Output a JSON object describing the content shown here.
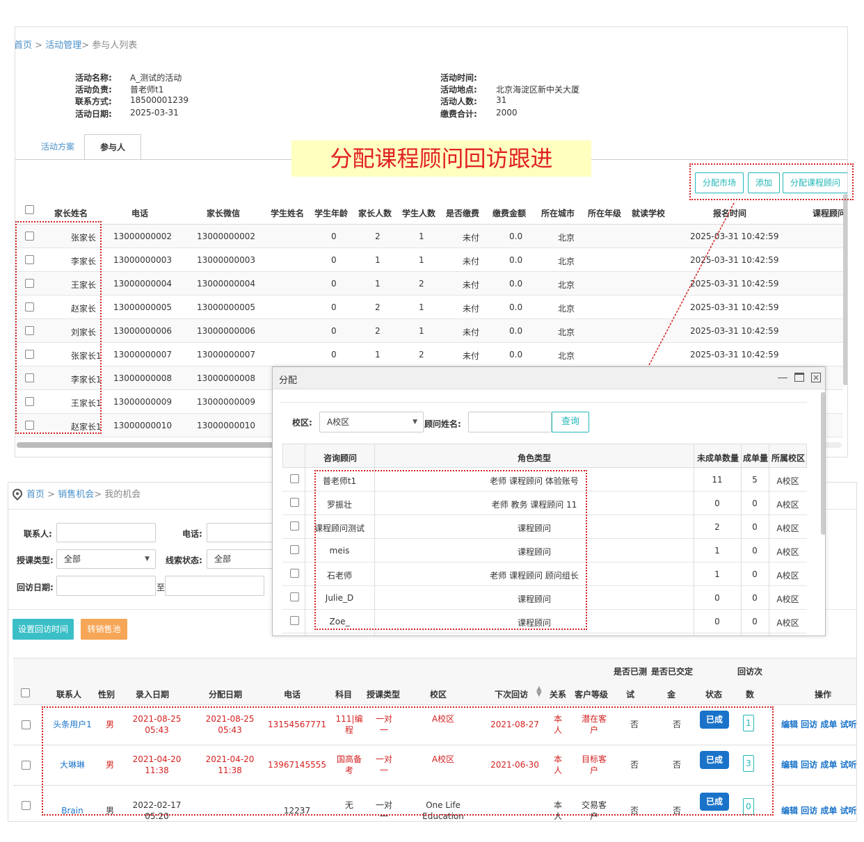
{
  "breadcrumb1": {
    "home": "首页",
    "sep1": " > ",
    "section": "活动管理",
    "sep2": "> ",
    "current": "参与人列表"
  },
  "activity": {
    "name_label": "活动名称:",
    "name": "A_测试的活动",
    "owner_label": "活动负责:",
    "owner": "普老师t1",
    "phone_label": "联系方式:",
    "phone": "18500001239",
    "date_label": "活动日期:",
    "date": "2025-03-31",
    "time_label": "活动时间:",
    "time": "",
    "place_label": "活动地点:",
    "place": "北京海淀区新中关大厦",
    "count_label": "活动人数:",
    "count": "31",
    "fee_label": "缴费合计:",
    "fee": "2000"
  },
  "tabs": {
    "plan": "活动方案",
    "participants": "参与人"
  },
  "banner": "分配课程顾问回访跟进",
  "toolbar": {
    "assign_market": "分配市场",
    "add": "添加",
    "assign_advisor": "分配课程顾问"
  },
  "participants": {
    "headers": {
      "parent_name": "家长姓名",
      "phone": "电话",
      "wechat": "家长微信",
      "student_name": "学生姓名",
      "student_age": "学生年龄",
      "parent_count": "家长人数",
      "student_count": "学生人数",
      "paid": "是否缴费",
      "amount": "缴费金额",
      "city": "所在城市",
      "grade": "所在年级",
      "school": "就读学校",
      "signup_time": "报名时间",
      "advisor": "课程顾问"
    },
    "rows": [
      {
        "name": "张家长",
        "phone": "13000000002",
        "wechat": "13000000002",
        "age": "0",
        "parents": "2",
        "students": "1",
        "paid": "未付",
        "amount": "0.0",
        "city": "北京",
        "time": "2025-03-31 10:42:59"
      },
      {
        "name": "李家长",
        "phone": "13000000003",
        "wechat": "13000000003",
        "age": "0",
        "parents": "1",
        "students": "1",
        "paid": "未付",
        "amount": "0.0",
        "city": "北京",
        "time": "2025-03-31 10:42:59"
      },
      {
        "name": "王家长",
        "phone": "13000000004",
        "wechat": "13000000004",
        "age": "0",
        "parents": "1",
        "students": "2",
        "paid": "未付",
        "amount": "0.0",
        "city": "北京",
        "time": "2025-03-31 10:42:59"
      },
      {
        "name": "赵家长",
        "phone": "13000000005",
        "wechat": "13000000005",
        "age": "0",
        "parents": "2",
        "students": "1",
        "paid": "未付",
        "amount": "0.0",
        "city": "北京",
        "time": "2025-03-31 10:42:59"
      },
      {
        "name": "刘家长",
        "phone": "13000000006",
        "wechat": "13000000006",
        "age": "0",
        "parents": "2",
        "students": "1",
        "paid": "未付",
        "amount": "0.0",
        "city": "北京",
        "time": "2025-03-31 10:42:59"
      },
      {
        "name": "张家长1",
        "phone": "13000000007",
        "wechat": "13000000007",
        "age": "0",
        "parents": "1",
        "students": "2",
        "paid": "未付",
        "amount": "0.0",
        "city": "北京",
        "time": "2025-03-31 10:42:59"
      },
      {
        "name": "李家长1",
        "phone": "13000000008",
        "wechat": "13000000008"
      },
      {
        "name": "王家长1",
        "phone": "13000000009",
        "wechat": "13000000009"
      },
      {
        "name": "赵家长1",
        "phone": "13000000010",
        "wechat": "13000000010"
      }
    ]
  },
  "dialog": {
    "title": "分配",
    "campus_label": "校区:",
    "campus_value": "A校区",
    "advisor_name_label": "顾问姓名:",
    "advisor_name_value": "",
    "search_button": "查询",
    "headers": {
      "advisor": "咨询顾问",
      "role": "角色类型",
      "open": "未成单数量",
      "closed": "成单量",
      "campus": "所属校区"
    },
    "rows": [
      {
        "name": "普老师t1",
        "role": "老师 课程顾问 体验账号",
        "open": "11",
        "closed": "5",
        "campus": "A校区"
      },
      {
        "name": "罗振壮",
        "role": "老师 教务 课程顾问 11",
        "open": "0",
        "closed": "0",
        "campus": "A校区"
      },
      {
        "name": "课程顾问测试",
        "role": "课程顾问",
        "open": "2",
        "closed": "0",
        "campus": "A校区"
      },
      {
        "name": "meis",
        "role": "课程顾问",
        "open": "1",
        "closed": "0",
        "campus": "A校区"
      },
      {
        "name": "石老师",
        "role": "老师 课程顾问 顾问组长",
        "open": "1",
        "closed": "0",
        "campus": "A校区"
      },
      {
        "name": "Julie_D",
        "role": "课程顾问",
        "open": "0",
        "closed": "0",
        "campus": "A校区"
      },
      {
        "name": "Zoe_",
        "role": "课程顾问",
        "open": "0",
        "closed": "0",
        "campus": "A校区"
      }
    ]
  },
  "breadcrumb2": {
    "home": "首页",
    "sep1": " > ",
    "section": "销售机会",
    "sep2": "> ",
    "current": "我的机会"
  },
  "filters": {
    "contact_label": "联系人:",
    "contact_value": "",
    "phone_label": "电话:",
    "phone_value": "",
    "course_type_label": "授课类型:",
    "course_type_value": "全部",
    "lead_status_label": "线索状态:",
    "lead_status_value": "全部",
    "visit_date_label": "回访日期:",
    "to_label": "至"
  },
  "actions": {
    "set_visit_time": "设置回访时间",
    "transfer_pool": "转销售池"
  },
  "opportunities": {
    "headers": {
      "contact": "联系人",
      "gender": "性别",
      "entry_date": "录入日期",
      "assign_date": "分配日期",
      "phone": "电话",
      "subject": "科目",
      "course_type": "授课类型",
      "campus": "校区",
      "next_visit": "下次回访",
      "relation": "关系",
      "level": "客户等级",
      "tested_a": "是否已测",
      "tested_b": "试",
      "paid_a": "是否已交定",
      "paid_b": "金",
      "status": "状态",
      "visits_a": "回访次",
      "visits_b": "数",
      "ops": "操作"
    },
    "rows": [
      {
        "contact": "头条用户1",
        "gender": "男",
        "entry_a": "2021-08-25",
        "entry_b": "05:43",
        "assign_a": "2021-08-25",
        "assign_b": "05:43",
        "phone": "13154567771",
        "subject_a": "111|编",
        "subject_b": "程",
        "type_a": "一对",
        "type_b": "一",
        "campus_a": "A校区",
        "campus_b": "",
        "next": "2021-08-27",
        "rel_a": "本",
        "rel_b": "人",
        "level_a": "潜在客",
        "level_b": "户",
        "tested": "否",
        "paid": "否",
        "status": "已成",
        "visits": "1",
        "ops": "编辑 回访 成单 试听",
        "red": true
      },
      {
        "contact": "大琳琳",
        "gender": "男",
        "entry_a": "2021-04-20",
        "entry_b": "11:38",
        "assign_a": "2021-04-20",
        "assign_b": "11:38",
        "phone": "13967145555",
        "subject_a": "国高备",
        "subject_b": "考",
        "type_a": "一对",
        "type_b": "一",
        "campus_a": "A校区",
        "campus_b": "",
        "next": "2021-06-30",
        "rel_a": "本",
        "rel_b": "人",
        "level_a": "目标客",
        "level_b": "户",
        "tested": "否",
        "paid": "否",
        "status": "已成",
        "visits": "3",
        "ops": "编辑 回访 成单 试听",
        "red": true
      },
      {
        "contact": "Brain",
        "gender": "男",
        "entry_a": "2022-02-17",
        "entry_b": "05:20",
        "assign_a": "",
        "assign_b": "",
        "phone": "12237",
        "subject_a": "无",
        "subject_b": "",
        "type_a": "一对",
        "type_b": "一",
        "campus_a": "One Life",
        "campus_b": "Education",
        "next": "",
        "rel_a": "本",
        "rel_b": "人",
        "level_a": "交易客",
        "level_b": "户",
        "tested": "否",
        "paid": "否",
        "status": "已成",
        "visits": "0",
        "ops": "编辑 回访 成单 试听",
        "red": false
      }
    ]
  },
  "colors": {
    "accent": "#23b7b7",
    "link": "#4a90c8",
    "highlight": "#d42020",
    "banner_bg": "#ffffc0",
    "status_blue": "#1a73c9",
    "orange": "#f6a657"
  }
}
